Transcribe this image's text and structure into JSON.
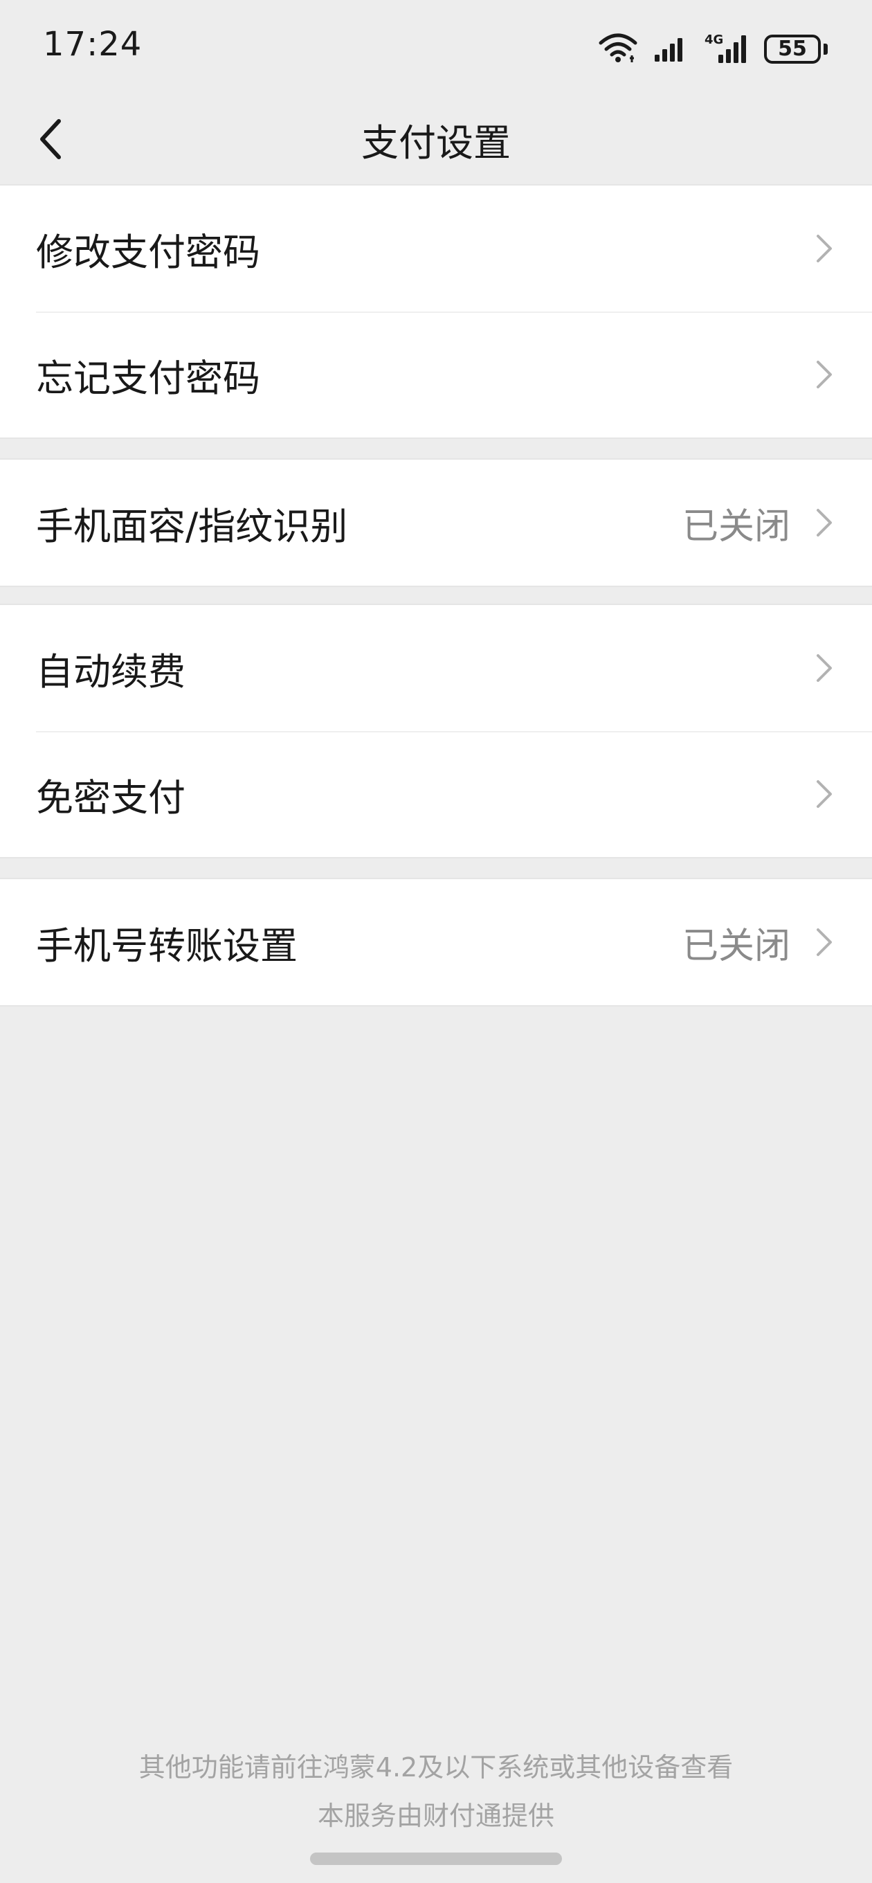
{
  "status_bar": {
    "time": "17:24",
    "network": "4G",
    "battery": "55",
    "battery_level": 0.55,
    "icons": [
      "wifi-icon",
      "signal-icon",
      "signal-4g-icon",
      "battery-icon"
    ]
  },
  "header": {
    "title": "支付设置",
    "back_icon": "chevron-left-icon"
  },
  "groups": [
    {
      "items": [
        {
          "label": "修改支付密码",
          "value": ""
        },
        {
          "label": "忘记支付密码",
          "value": ""
        }
      ]
    },
    {
      "items": [
        {
          "label": "手机面容/指纹识别",
          "value": "已关闭"
        }
      ]
    },
    {
      "items": [
        {
          "label": "自动续费",
          "value": ""
        },
        {
          "label": "免密支付",
          "value": ""
        }
      ]
    },
    {
      "items": [
        {
          "label": "手机号转账设置",
          "value": "已关闭"
        }
      ]
    }
  ],
  "footer": {
    "line1": "其他功能请前往鸿蒙4.2及以下系统或其他设备查看",
    "line2": "本服务由财付通提供"
  },
  "colors": {
    "background": "#ededed",
    "cell_background": "#ffffff",
    "text_primary": "#191919",
    "text_secondary": "#8a8a8a",
    "chevron": "#b2b2b2"
  }
}
